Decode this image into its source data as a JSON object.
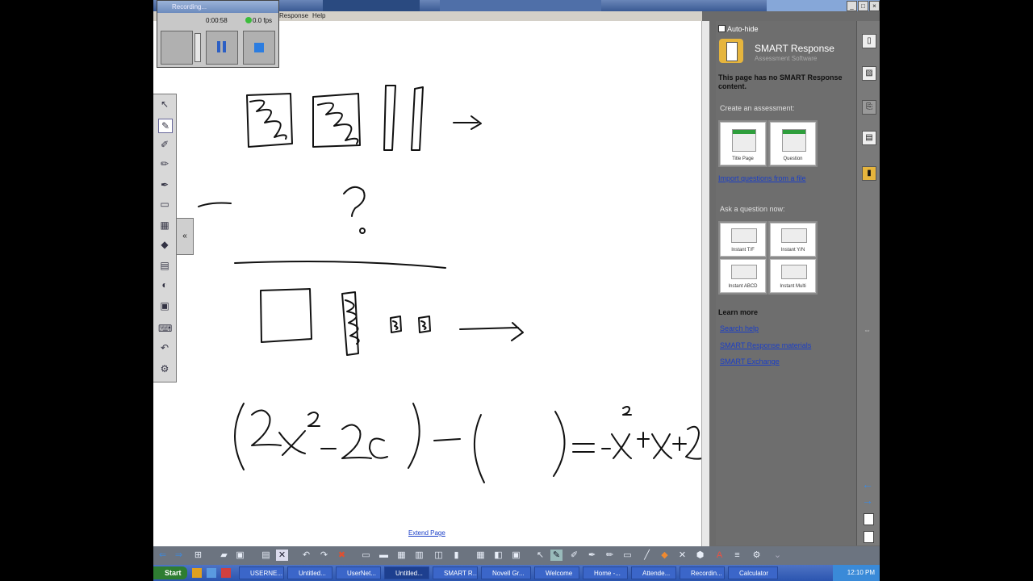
{
  "menu": {
    "response": "Response",
    "help": "Help"
  },
  "recorder": {
    "title": "Recording...",
    "time": "0:00:58",
    "fps": "0.0 fps"
  },
  "canvas": {
    "extend_link": "Extend Page"
  },
  "panel": {
    "autohide_label": "Auto-hide",
    "title": "SMART Response",
    "subtitle": "Assessment Software",
    "notice": "This page has no SMART Response content.",
    "create_label": "Create an assessment:",
    "create_cards": [
      {
        "label": "Title Page"
      },
      {
        "label": "Question"
      }
    ],
    "import_link": "Import questions from a file",
    "ask_label": "Ask a question now:",
    "ask_cards": [
      {
        "label": "Instant T/F"
      },
      {
        "label": "Instant Y/N"
      },
      {
        "label": "Instant ABCD"
      },
      {
        "label": "Instant Multi"
      }
    ],
    "learn_label": "Learn more",
    "learn_links": [
      "Search help",
      "SMART Response materials",
      "SMART Exchange"
    ]
  },
  "taskbar": {
    "start_label": "Start",
    "tasks": [
      "USERNE...",
      "Untitled...",
      "UserNet...",
      "Untitled...",
      "SMART R...",
      "Novell Gr...",
      "Welcome",
      "Home -...",
      "Attende...",
      "Recordin...",
      "Calculator"
    ],
    "clock": "12:10 PM"
  },
  "colors": {
    "canvas_bg": "#ffffff",
    "panel_bg": "#6e6e6e",
    "taskbar_bg": "#2b55b0",
    "link": "#1a3ec7"
  }
}
